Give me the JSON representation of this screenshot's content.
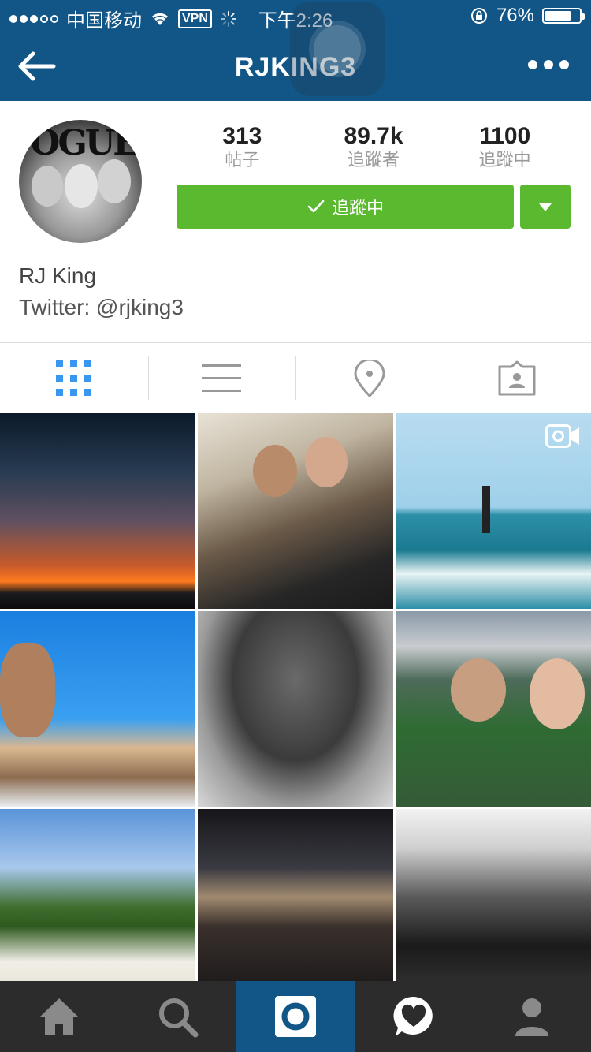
{
  "status_bar": {
    "carrier": "中国移动",
    "vpn": "VPN",
    "time": "下午2:26",
    "battery": "76%",
    "battery_level": 0.76
  },
  "nav": {
    "title": "RJKING3"
  },
  "profile": {
    "posts_count": "313",
    "posts_label": "帖子",
    "followers_count": "89.7k",
    "followers_label": "追蹤者",
    "following_count": "1100",
    "following_label": "追蹤中",
    "follow_button_label": "追蹤中",
    "name": "RJ King",
    "bio": "Twitter: @rjking3",
    "avatar_text": "OGUE"
  },
  "tabs": [
    {
      "name": "grid-view",
      "icon": "grid-icon",
      "active": true
    },
    {
      "name": "list-view",
      "icon": "list-icon",
      "active": false
    },
    {
      "name": "places",
      "icon": "location-pin-icon",
      "active": false
    },
    {
      "name": "tagged",
      "icon": "tagged-person-icon",
      "active": false
    }
  ],
  "grid": [
    {
      "name": "sunset-sky"
    },
    {
      "name": "two-men-hug"
    },
    {
      "name": "flyboard-ocean",
      "video": true
    },
    {
      "name": "boat-group"
    },
    {
      "name": "mud-bath"
    },
    {
      "name": "stadium-selfie"
    },
    {
      "name": "beach-palm"
    },
    {
      "name": "night-palm-selfie"
    },
    {
      "name": "group-bw"
    }
  ],
  "bottom_bar": [
    {
      "name": "home",
      "icon": "home-icon",
      "active": false
    },
    {
      "name": "search",
      "icon": "search-icon",
      "active": false
    },
    {
      "name": "camera",
      "icon": "camera-icon",
      "active": true
    },
    {
      "name": "activity",
      "icon": "heart-bubble-icon",
      "active": false
    },
    {
      "name": "profile",
      "icon": "person-icon",
      "active": false
    }
  ],
  "colors": {
    "header": "#125688",
    "follow_green": "#5ab92f",
    "tab_active": "#3897f0",
    "tab_inactive": "#999999",
    "bottom_bar": "#2c2c2c"
  }
}
